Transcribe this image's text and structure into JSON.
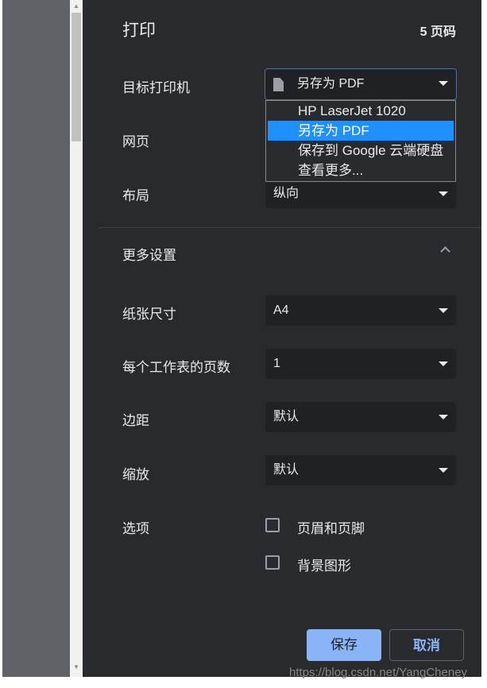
{
  "header": {
    "title": "打印",
    "page_count": "5 页码"
  },
  "destination": {
    "label": "目标打印机",
    "value": "另存为 PDF",
    "icon": "file-icon",
    "options": [
      "HP LaserJet 1020",
      "另存为 PDF",
      "保存到 Google 云端硬盘",
      "查看更多..."
    ],
    "highlight_color": "#1e90ff"
  },
  "pages": {
    "label": "网页"
  },
  "layout": {
    "label": "布局",
    "value": "纵向"
  },
  "more_settings": {
    "label": "更多设置"
  },
  "paper_size": {
    "label": "纸张尺寸",
    "value": "A4"
  },
  "pages_per_sheet": {
    "label": "每个工作表的页数",
    "value": "1"
  },
  "margins": {
    "label": "边距",
    "value": "默认"
  },
  "scale": {
    "label": "缩放",
    "value": "默认"
  },
  "options": {
    "label": "选项",
    "items": [
      {
        "label": "页眉和页脚",
        "checked": false
      },
      {
        "label": "背景图形",
        "checked": false
      }
    ]
  },
  "buttons": {
    "save": "保存",
    "cancel": "取消"
  },
  "watermark": "https://blog.csdn.net/YangCheney"
}
